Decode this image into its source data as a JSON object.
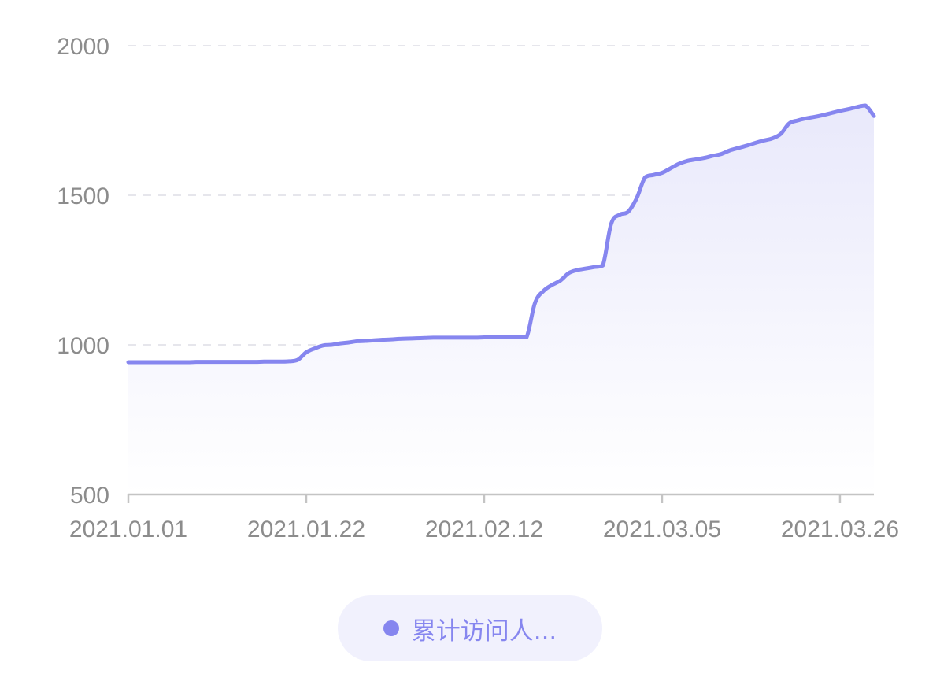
{
  "colors": {
    "series": "#8686ef",
    "area_top": "#e9e9fb",
    "area_bottom": "#ffffff",
    "grid": "#e6e6ec",
    "axis": "#c4c4c4",
    "tick_text": "#8c8c8c",
    "legend_bg": "#f1f1fd",
    "legend_text": "#8686ef"
  },
  "legend": {
    "label": "累计访问人...",
    "marker": "legend-dot"
  },
  "chart_data": {
    "type": "area",
    "title": "",
    "xlabel": "",
    "ylabel": "",
    "ylim": [
      500,
      2000
    ],
    "yticks": [
      500,
      1000,
      1500,
      2000
    ],
    "xticks": [
      "2021.01.01",
      "2021.01.22",
      "2021.02.12",
      "2021.03.05",
      "2021.03.26"
    ],
    "grid": true,
    "legend_position": "bottom-center",
    "series": [
      {
        "name": "累计访问人...",
        "x": [
          "2021.01.01",
          "2021.01.02",
          "2021.01.03",
          "2021.01.04",
          "2021.01.05",
          "2021.01.06",
          "2021.01.07",
          "2021.01.08",
          "2021.01.09",
          "2021.01.10",
          "2021.01.11",
          "2021.01.12",
          "2021.01.13",
          "2021.01.14",
          "2021.01.15",
          "2021.01.16",
          "2021.01.17",
          "2021.01.18",
          "2021.01.19",
          "2021.01.20",
          "2021.01.21",
          "2021.01.22",
          "2021.01.23",
          "2021.01.24",
          "2021.01.25",
          "2021.01.26",
          "2021.01.27",
          "2021.01.28",
          "2021.01.29",
          "2021.01.30",
          "2021.01.31",
          "2021.02.01",
          "2021.02.02",
          "2021.02.03",
          "2021.02.04",
          "2021.02.05",
          "2021.02.06",
          "2021.02.07",
          "2021.02.08",
          "2021.02.09",
          "2021.02.10",
          "2021.02.11",
          "2021.02.12",
          "2021.02.13",
          "2021.02.14",
          "2021.02.15",
          "2021.02.16",
          "2021.02.17",
          "2021.02.18",
          "2021.02.19",
          "2021.02.20",
          "2021.02.21",
          "2021.02.22",
          "2021.02.23",
          "2021.02.24",
          "2021.02.25",
          "2021.02.26",
          "2021.02.27",
          "2021.02.28",
          "2021.03.01",
          "2021.03.02",
          "2021.03.03",
          "2021.03.04",
          "2021.03.05",
          "2021.03.06",
          "2021.03.07",
          "2021.03.08",
          "2021.03.09",
          "2021.03.10",
          "2021.03.11",
          "2021.03.12",
          "2021.03.13",
          "2021.03.14",
          "2021.03.15",
          "2021.03.16",
          "2021.03.17",
          "2021.03.18",
          "2021.03.19",
          "2021.03.20",
          "2021.03.21",
          "2021.03.22",
          "2021.03.23",
          "2021.03.24",
          "2021.03.25",
          "2021.03.26",
          "2021.03.27",
          "2021.03.28",
          "2021.03.29",
          "2021.03.30"
        ],
        "values": [
          942,
          942,
          942,
          942,
          942,
          942,
          942,
          942,
          943,
          943,
          943,
          943,
          943,
          943,
          943,
          943,
          944,
          944,
          944,
          945,
          950,
          975,
          988,
          998,
          1000,
          1005,
          1008,
          1012,
          1013,
          1015,
          1017,
          1018,
          1020,
          1021,
          1022,
          1023,
          1024,
          1024,
          1024,
          1024,
          1024,
          1024,
          1025,
          1025,
          1025,
          1025,
          1025,
          1025,
          1140,
          1180,
          1200,
          1215,
          1240,
          1250,
          1255,
          1260,
          1265,
          1405,
          1435,
          1445,
          1490,
          1560,
          1568,
          1575,
          1590,
          1605,
          1615,
          1620,
          1625,
          1632,
          1638,
          1650,
          1658,
          1666,
          1675,
          1683,
          1690,
          1705,
          1740,
          1750,
          1757,
          1762,
          1768,
          1775,
          1782,
          1788,
          1795,
          1800,
          1765
        ]
      }
    ]
  }
}
